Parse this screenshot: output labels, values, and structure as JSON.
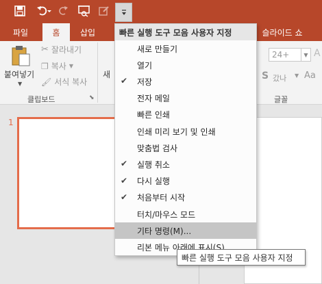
{
  "qat": {
    "icons": [
      "save-icon",
      "undo-icon",
      "redo-icon",
      "present-from-beginning-icon",
      "touch-mouse-mode-icon",
      "customize-qat-icon"
    ]
  },
  "tabs": [
    "파일",
    "홈",
    "삽입",
    "슬라이드 쇼"
  ],
  "ribbon": {
    "paste_label": "붙여넣기",
    "cut_label": "잘라내기",
    "copy_label": "복사",
    "format_painter_label": "서식 복사",
    "clipboard_group_label": "클립보드",
    "new_slide_partial": "새",
    "font_size_value": "24+",
    "font_group_label": "글꼴",
    "spacing_label": "갔나",
    "shadow_label": "S",
    "aa_label": "Aa"
  },
  "slide": {
    "number": "1"
  },
  "menu": {
    "header": "빠른 실행 도구 모음 사용자 지정",
    "items": [
      {
        "label": "새로 만들기",
        "checked": false
      },
      {
        "label": "열기",
        "checked": false
      },
      {
        "label": "저장",
        "checked": true
      },
      {
        "label": "전자 메일",
        "checked": false
      },
      {
        "label": "빠른 인쇄",
        "checked": false
      },
      {
        "label": "인쇄 미리 보기 및 인쇄",
        "checked": false
      },
      {
        "label": "맞춤법 검사",
        "checked": false
      },
      {
        "label": "실행 취소",
        "checked": true
      },
      {
        "label": "다시 실행",
        "checked": true
      },
      {
        "label": "처음부터 시작",
        "checked": true
      },
      {
        "label": "터치/마우스 모드",
        "checked": false
      },
      {
        "label": "기타 명령(M)...",
        "checked": false
      },
      {
        "label": "리본 메뉴 아래에 표시(S)",
        "checked": false
      }
    ],
    "hovered_index": 11
  },
  "tooltip": "빠른 실행 도구 모음 사용자 지정",
  "colors": {
    "accent": "#b7472a",
    "ribbon_bg": "#f3f3f3",
    "slide_border": "#e46c4a"
  }
}
